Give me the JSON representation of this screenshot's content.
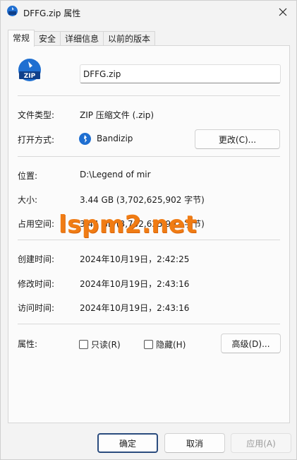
{
  "window": {
    "title": "DFFG.zip 属性",
    "close_glyph": "✕"
  },
  "tabs": [
    {
      "label": "常规",
      "active": true
    },
    {
      "label": "安全",
      "active": false
    },
    {
      "label": "详细信息",
      "active": false
    },
    {
      "label": "以前的版本",
      "active": false
    }
  ],
  "file": {
    "icon_text": "ZIP",
    "name": "DFFG.zip"
  },
  "general": {
    "type_label": "文件类型:",
    "type_value": "ZIP 压缩文件 (.zip)",
    "opens_label": "打开方式:",
    "opens_value": "Bandizip",
    "change_button": "更改(C)...",
    "location_label": "位置:",
    "location_value": "D:\\Legend of mir",
    "size_label": "大小:",
    "size_value": "3.44 GB (3,702,625,902 字节)",
    "disk_label": "占用空间:",
    "disk_value": "3.44 GB (3,702,625,902 字节)",
    "created_label": "创建时间:",
    "created_value": "2024年10月19日，2:42:25",
    "modified_label": "修改时间:",
    "modified_value": "2024年10月19日，2:43:16",
    "accessed_label": "访问时间:",
    "accessed_value": "2024年10月19日，2:43:16",
    "attributes_label": "属性:",
    "readonly_label": "只读(R)",
    "hidden_label": "隐藏(H)",
    "advanced_button": "高级(D)..."
  },
  "watermark": "lspm2.net",
  "footer": {
    "ok": "确定",
    "cancel": "取消",
    "apply": "应用(A)"
  },
  "colors": {
    "accent": "#2b4c7e",
    "icon_blue": "#1f6fd1",
    "watermark": "#f07c14"
  }
}
